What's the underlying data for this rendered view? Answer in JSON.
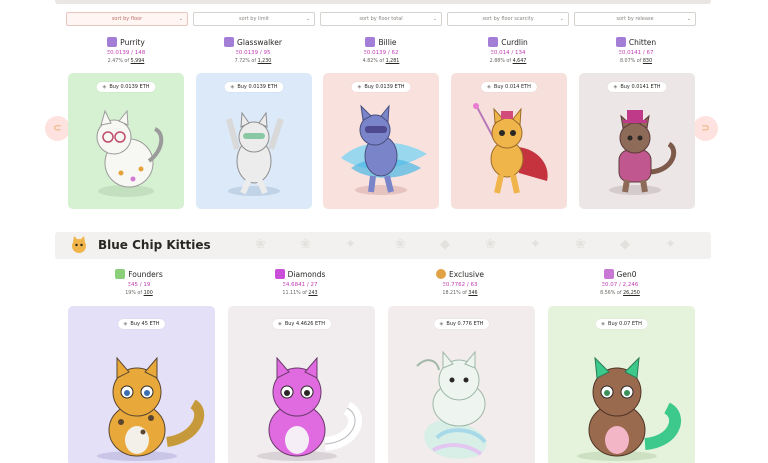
{
  "sort": [
    {
      "label": "sort by floor",
      "active": true
    },
    {
      "label": "sort by limit",
      "active": false
    },
    {
      "label": "sort by floor total",
      "active": false
    },
    {
      "label": "sort by floor scarcity",
      "active": false
    },
    {
      "label": "sort by release",
      "active": false
    }
  ],
  "top_kitties": [
    {
      "name": "Purrity",
      "price": "Ξ0.0139 / 148",
      "pct": "2.47% of",
      "total": "5,994",
      "buy": "Buy 0.0139 ETH",
      "bg": "#d6f0d2",
      "icon_color": "#a27ed6"
    },
    {
      "name": "Glasswalker",
      "price": "Ξ0.0139 / 95",
      "pct": "7.72% of",
      "total": "1,230",
      "buy": "Buy 0.0139 ETH",
      "bg": "#dbe9f8",
      "icon_color": "#a27ed6"
    },
    {
      "name": "Billie",
      "price": "Ξ0.0139 / 62",
      "pct": "4.82% of",
      "total": "1,281",
      "buy": "Buy 0.0139 ETH",
      "bg": "#f9e2de",
      "icon_color": "#a27ed6"
    },
    {
      "name": "Curdlin",
      "price": "Ξ0.014 / 134",
      "pct": "2.88% of",
      "total": "4,647",
      "buy": "Buy 0.014 ETH",
      "bg": "#f7e0dc",
      "icon_color": "#a27ed6"
    },
    {
      "name": "Chitten",
      "price": "Ξ0.0141 / 67",
      "pct": "8.07% of",
      "total": "830",
      "buy": "Buy 0.0141 ETH",
      "bg": "#ece6e6",
      "icon_color": "#a27ed6"
    }
  ],
  "carousel": {
    "prev_icon": "arrow-left-icon",
    "next_icon": "arrow-right-icon",
    "prev_glyph": "⊂",
    "next_glyph": "⊃"
  },
  "section": {
    "title": "Blue Chip Kitties"
  },
  "blue_chip": [
    {
      "name": "Founders",
      "price": "Ξ45 / 19",
      "pct": "19% of",
      "total": "100",
      "buy": "Buy 45 ETH",
      "bg": "#e3e0f7",
      "icon_color": "#8ccf7a"
    },
    {
      "name": "Diamonds",
      "price": "Ξ4.6841 / 27",
      "pct": "11.11% of",
      "total": "243",
      "buy": "Buy 4.4626 ETH",
      "bg": "#f1ecee",
      "icon_color": "#c94fd9"
    },
    {
      "name": "Exclusive",
      "price": "Ξ0.7762 / 63",
      "pct": "18.21% of",
      "total": "346",
      "buy": "Buy 0.776 ETH",
      "bg": "#f3ecec",
      "icon_color": "#e0a245"
    },
    {
      "name": "Gen0",
      "price": "Ξ0.07 / 2,246",
      "pct": "8.56% of",
      "total": "26,250",
      "buy": "Buy 0.07 ETH",
      "bg": "#e6f3dc",
      "icon_color": "#c978d6"
    }
  ]
}
